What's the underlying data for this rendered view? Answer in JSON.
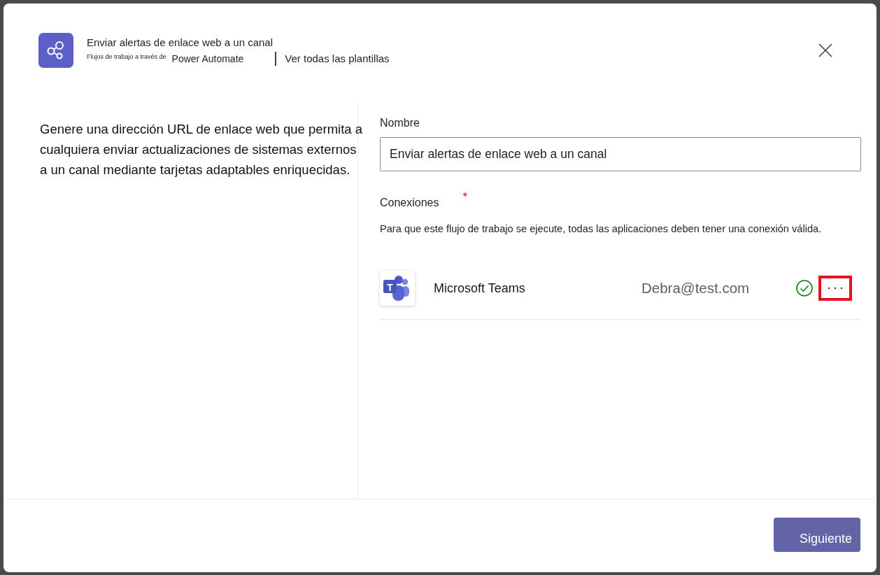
{
  "header": {
    "title": "Enviar alertas de enlace web a un canal",
    "provider_prefix": "Flujos de trabajo a través de",
    "provider": "Power Automate",
    "templates_link": "Ver todas las plantillas"
  },
  "description": "Genere una dirección URL de enlace web que permita a cualquiera enviar actualizaciones de sistemas externos a un canal mediante tarjetas adaptables enriquecidas.",
  "form": {
    "name_label": "Nombre",
    "name_value": "Enviar alertas de enlace web a un canal",
    "connections_label": "Conexiones",
    "required_mark": "*",
    "connections_note": "Para que este flujo de trabajo se ejecute, todas las aplicaciones deben tener una conexión válida."
  },
  "connections": [
    {
      "app": "Microsoft Teams",
      "logo_letter": "T",
      "account": "Debra@test.com",
      "valid": true,
      "highlighted": true
    }
  ],
  "footer": {
    "next_button": "Siguiente"
  }
}
